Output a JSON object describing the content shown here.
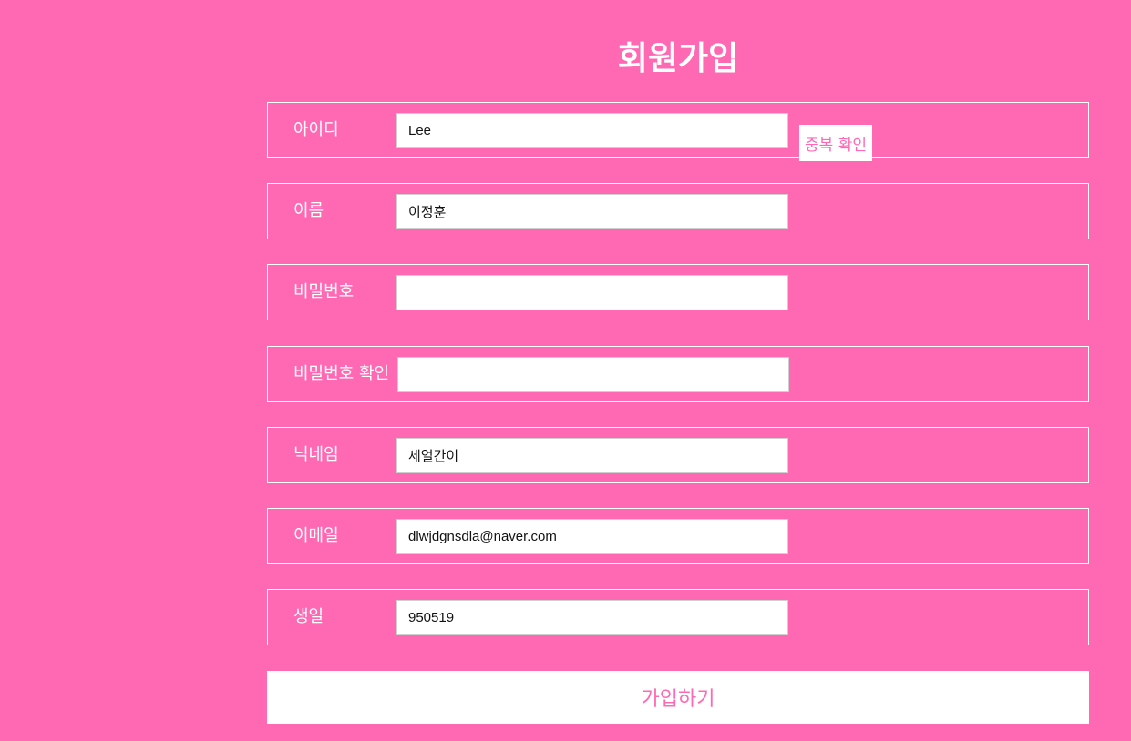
{
  "page": {
    "title": "회원가입",
    "background_color": "#ff69b4"
  },
  "fields": {
    "id": {
      "label": "아이디",
      "value": "Lee",
      "action_label": "중복 확인"
    },
    "name": {
      "label": "이름",
      "value": "이정훈"
    },
    "password": {
      "label": "비밀번호",
      "value": ""
    },
    "password_confirm": {
      "label": "비밀번호 확인",
      "value": ""
    },
    "nickname": {
      "label": "닉네임",
      "value": "세얼간이"
    },
    "email": {
      "label": "이메일",
      "value": "dlwjdgnsdla@naver.com"
    },
    "birthday": {
      "label": "생일",
      "value": "950519"
    }
  },
  "submit": {
    "label": "가입하기"
  }
}
